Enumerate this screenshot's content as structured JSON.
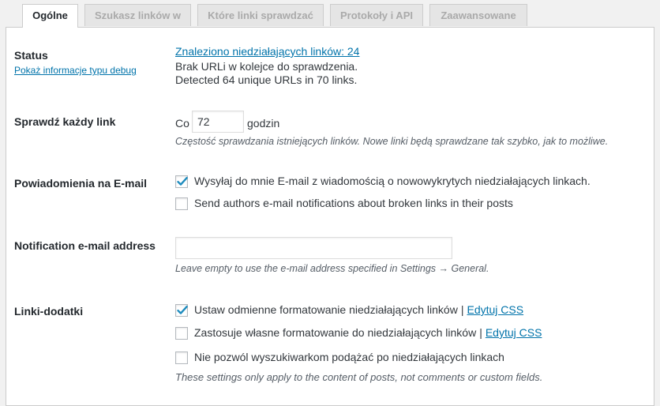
{
  "tabs": [
    {
      "label": "Ogólne",
      "active": true
    },
    {
      "label": "Szukasz linków w",
      "active": false
    },
    {
      "label": "Które linki sprawdzać",
      "active": false
    },
    {
      "label": "Protokoły i API",
      "active": false
    },
    {
      "label": "Zaawansowane",
      "active": false
    }
  ],
  "status": {
    "label": "Status",
    "debug_link": "Pokaż informacje typu debug",
    "broken_links": "Znaleziono niedziałających linków: 24",
    "queue": "Brak URLi w kolejce do sprawdzenia.",
    "detected": "Detected 64 unique URLs in 70 links."
  },
  "check_every": {
    "label": "Sprawdź każdy link",
    "prefix": "Co",
    "value": "72",
    "suffix": "godzin",
    "description": "Częstość sprawdzania istniejących linków. Nowe linki będą sprawdzane tak szybko, jak to możliwe."
  },
  "email_notifications": {
    "label": "Powiadomienia na E-mail",
    "options": [
      {
        "label": "Wysyłaj do mnie E-mail z wiadomością o nowowykrytych niedziałających linkach.",
        "checked": true
      },
      {
        "label": "Send authors e-mail notifications about broken links in their posts",
        "checked": false
      }
    ]
  },
  "notification_address": {
    "label": "Notification e-mail address",
    "value": "",
    "description": "Leave empty to use the e-mail address specified in Settings → General."
  },
  "link_tweaks": {
    "label": "Linki-dodatki",
    "options": [
      {
        "label": "Ustaw odmienne formatowanie niedziałających linków",
        "separator": "|",
        "link": "Edytuj CSS",
        "checked": true
      },
      {
        "label": "Zastosuje własne formatowanie do niedziałających linków",
        "separator": "|",
        "link": "Edytuj CSS",
        "checked": false
      },
      {
        "label": "Nie pozwól wyszukiwarkom podążać po niedziałających linkach",
        "checked": false
      }
    ],
    "description": "These settings only apply to the content of posts, not comments or custom fields."
  },
  "colors": {
    "link": "#0073aa",
    "check": "#1e8cbe"
  }
}
